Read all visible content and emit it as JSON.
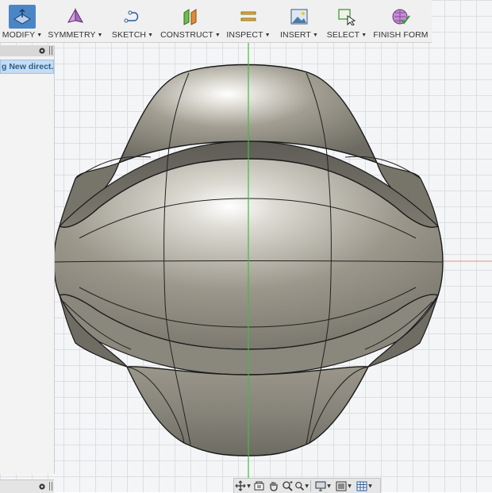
{
  "toolbar": {
    "items": [
      {
        "label": "MODIFY",
        "icon": "modify-icon",
        "active": true
      },
      {
        "label": "SYMMETRY",
        "icon": "symmetry-icon"
      },
      {
        "label": "SKETCH",
        "icon": "sketch-icon"
      },
      {
        "label": "CONSTRUCT",
        "icon": "construct-icon"
      },
      {
        "label": "INSPECT",
        "icon": "inspect-icon"
      },
      {
        "label": "INSERT",
        "icon": "insert-icon"
      },
      {
        "label": "SELECT",
        "icon": "select-icon"
      },
      {
        "label": "FINISH FORM",
        "icon": "finish-form-icon"
      }
    ]
  },
  "browser": {
    "item_label": "g New direct..."
  },
  "navbar": {
    "buttons": [
      "orbit-icon",
      "look-at-icon",
      "pan-icon",
      "zoom-window-icon",
      "zoom-icon",
      "display-settings-icon",
      "visual-style-icon",
      "grid-settings-icon"
    ]
  },
  "colors": {
    "accent": "#4a86c5",
    "selection": "#c5dcf2",
    "axis_green": "#3fbf3f",
    "axis_red": "#e07070",
    "body_metal": "#8b8778"
  }
}
